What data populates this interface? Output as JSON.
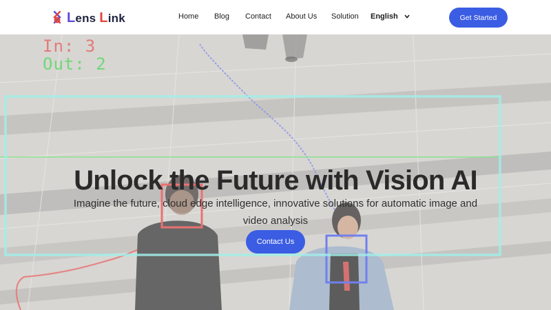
{
  "brand": {
    "name_part1_initial": "L",
    "name_part1_rest": "ens",
    "name_part2_initial": "L",
    "name_part2_rest": "ink",
    "logo_icon": "lens-link-logo-icon"
  },
  "nav": {
    "items": [
      {
        "label": "Home"
      },
      {
        "label": "Blog"
      },
      {
        "label": "Contact"
      },
      {
        "label": "About Us"
      },
      {
        "label": "Solution"
      }
    ],
    "language": "English",
    "language_icon": "chevron-down-icon",
    "cta_label": "Get Started"
  },
  "hero": {
    "counter_in": "In: 3",
    "counter_out": "Out: 2",
    "title": "Unlock the Future with Vision AI",
    "subtitle": "Imagine the future, cloud edge intelligence, innovative solutions for automatic image and video analysis",
    "cta_label": "Contact Us"
  },
  "colors": {
    "primary": "#3b5de3",
    "text_dark": "#2a2a2a",
    "counter_in": "#e66a6a",
    "counter_out": "#5fd86a",
    "detect_box_red": "#e23b3b",
    "detect_box_blue": "#3b4fe6",
    "zone_box_cyan": "#7ee8e0"
  }
}
